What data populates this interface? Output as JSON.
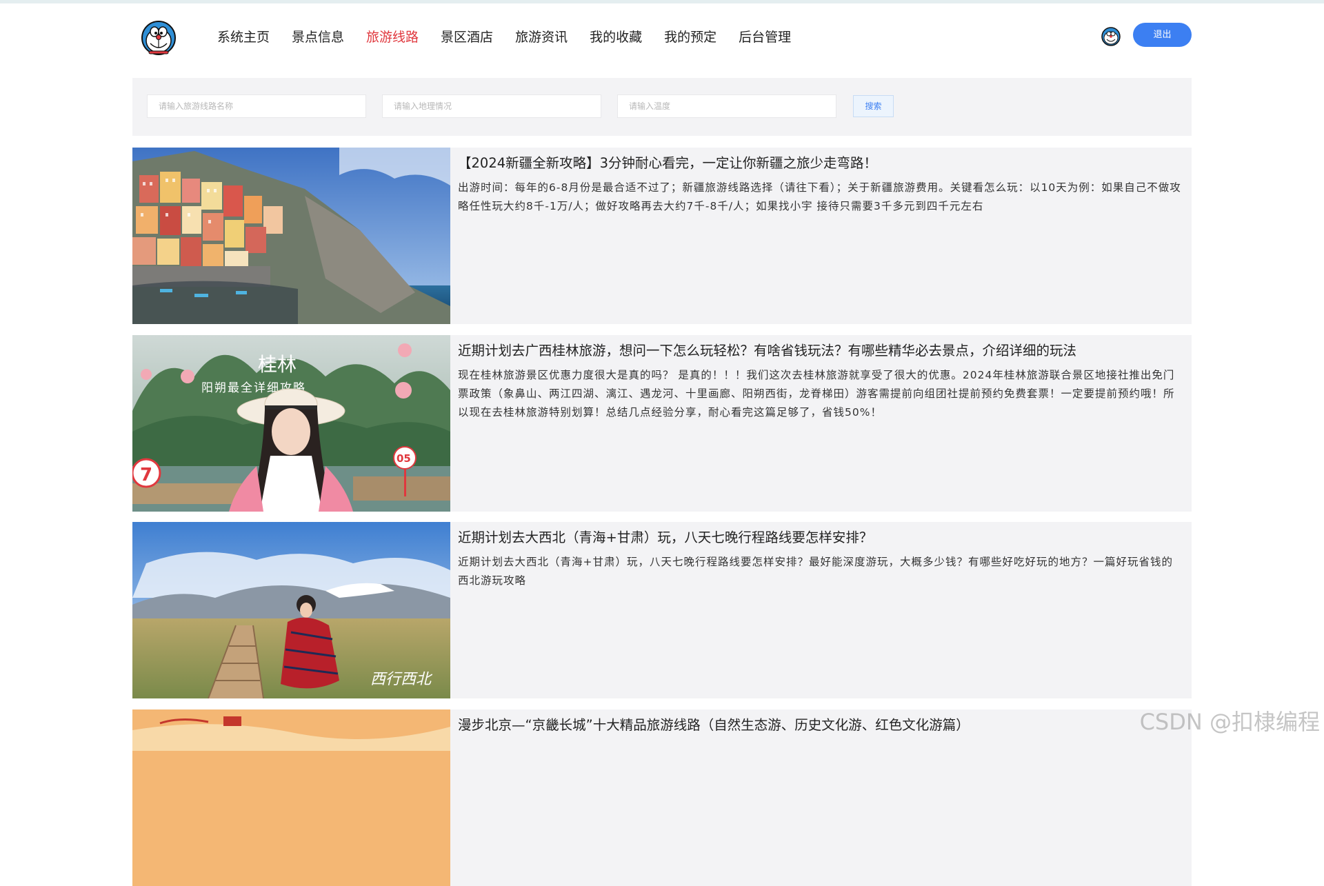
{
  "nav": {
    "items": [
      {
        "label": "系统主页",
        "active": false
      },
      {
        "label": "景点信息",
        "active": false
      },
      {
        "label": "旅游线路",
        "active": true
      },
      {
        "label": "景区酒店",
        "active": false
      },
      {
        "label": "旅游资讯",
        "active": false
      },
      {
        "label": "我的收藏",
        "active": false
      },
      {
        "label": "我的预定",
        "active": false
      },
      {
        "label": "后台管理",
        "active": false
      }
    ],
    "logout_label": "退出"
  },
  "search": {
    "name_placeholder": "请输入旅游线路名称",
    "geo_placeholder": "请输入地理情况",
    "temp_placeholder": "请输入温度",
    "button_label": "搜索"
  },
  "routes": [
    {
      "title": "【2024新疆全新攻略】3分钟耐心看完，一定让你新疆之旅少走弯路！",
      "desc": "出游时间：每年的6-8月份是最合适不过了；新疆旅游线路选择（请往下看）；关于新疆旅游费用。关键看怎么玩：以10天为例：如果自己不做攻略任性玩大约8千-1万/人；做好攻略再去大约7千-8千/人；如果找小宇 接待只需要3千多元到四千元左右",
      "image_text": ""
    },
    {
      "title": "近期计划去广西桂林旅游，想问一下怎么玩轻松？有啥省钱玩法？有哪些精华必去景点，介绍详细的玩法",
      "desc": "现在桂林旅游景区优惠力度很大是真的吗？ 是真的！！！我们这次去桂林旅游就享受了很大的优惠。2024年桂林旅游联合景区地接社推出免门票政策（象鼻山、两江四湖、漓江、遇龙河、十里画廊、阳朔西街，龙脊梯田）游客需提前向组团社提前预约免费套票！一定要提前预约哦！所以现在去桂林旅游特别划算！总结几点经验分享，耐心看完这篇足够了，省钱50%！",
      "image_text": {
        "title": "桂林",
        "subtitle": "阳朔最全详细攻略",
        "badge_left": "7",
        "badge_right": "05"
      }
    },
    {
      "title": "近期计划去大西北（青海+甘肃）玩，八天七晚行程路线要怎样安排？",
      "desc": "近期计划去大西北（青海+甘肃）玩，八天七晚行程路线要怎样安排？最好能深度游玩，大概多少钱？有哪些好吃好玩的地方？一篇好玩省钱的西北游玩攻略",
      "image_text": {
        "caption": "西行西北"
      }
    },
    {
      "title": "漫步北京—“京畿长城”十大精品旅游线路（自然生态游、历史文化游、红色文化游篇）",
      "desc": "",
      "image_text": ""
    }
  ],
  "watermark": "CSDN @扣棣编程",
  "colors": {
    "accent": "#3c7ff2",
    "nav_active": "#e0383e",
    "panel_bg": "#f3f3f5"
  },
  "icons": {
    "logo": "doraemon-logo-icon",
    "avatar": "doraemon-avatar-icon"
  }
}
